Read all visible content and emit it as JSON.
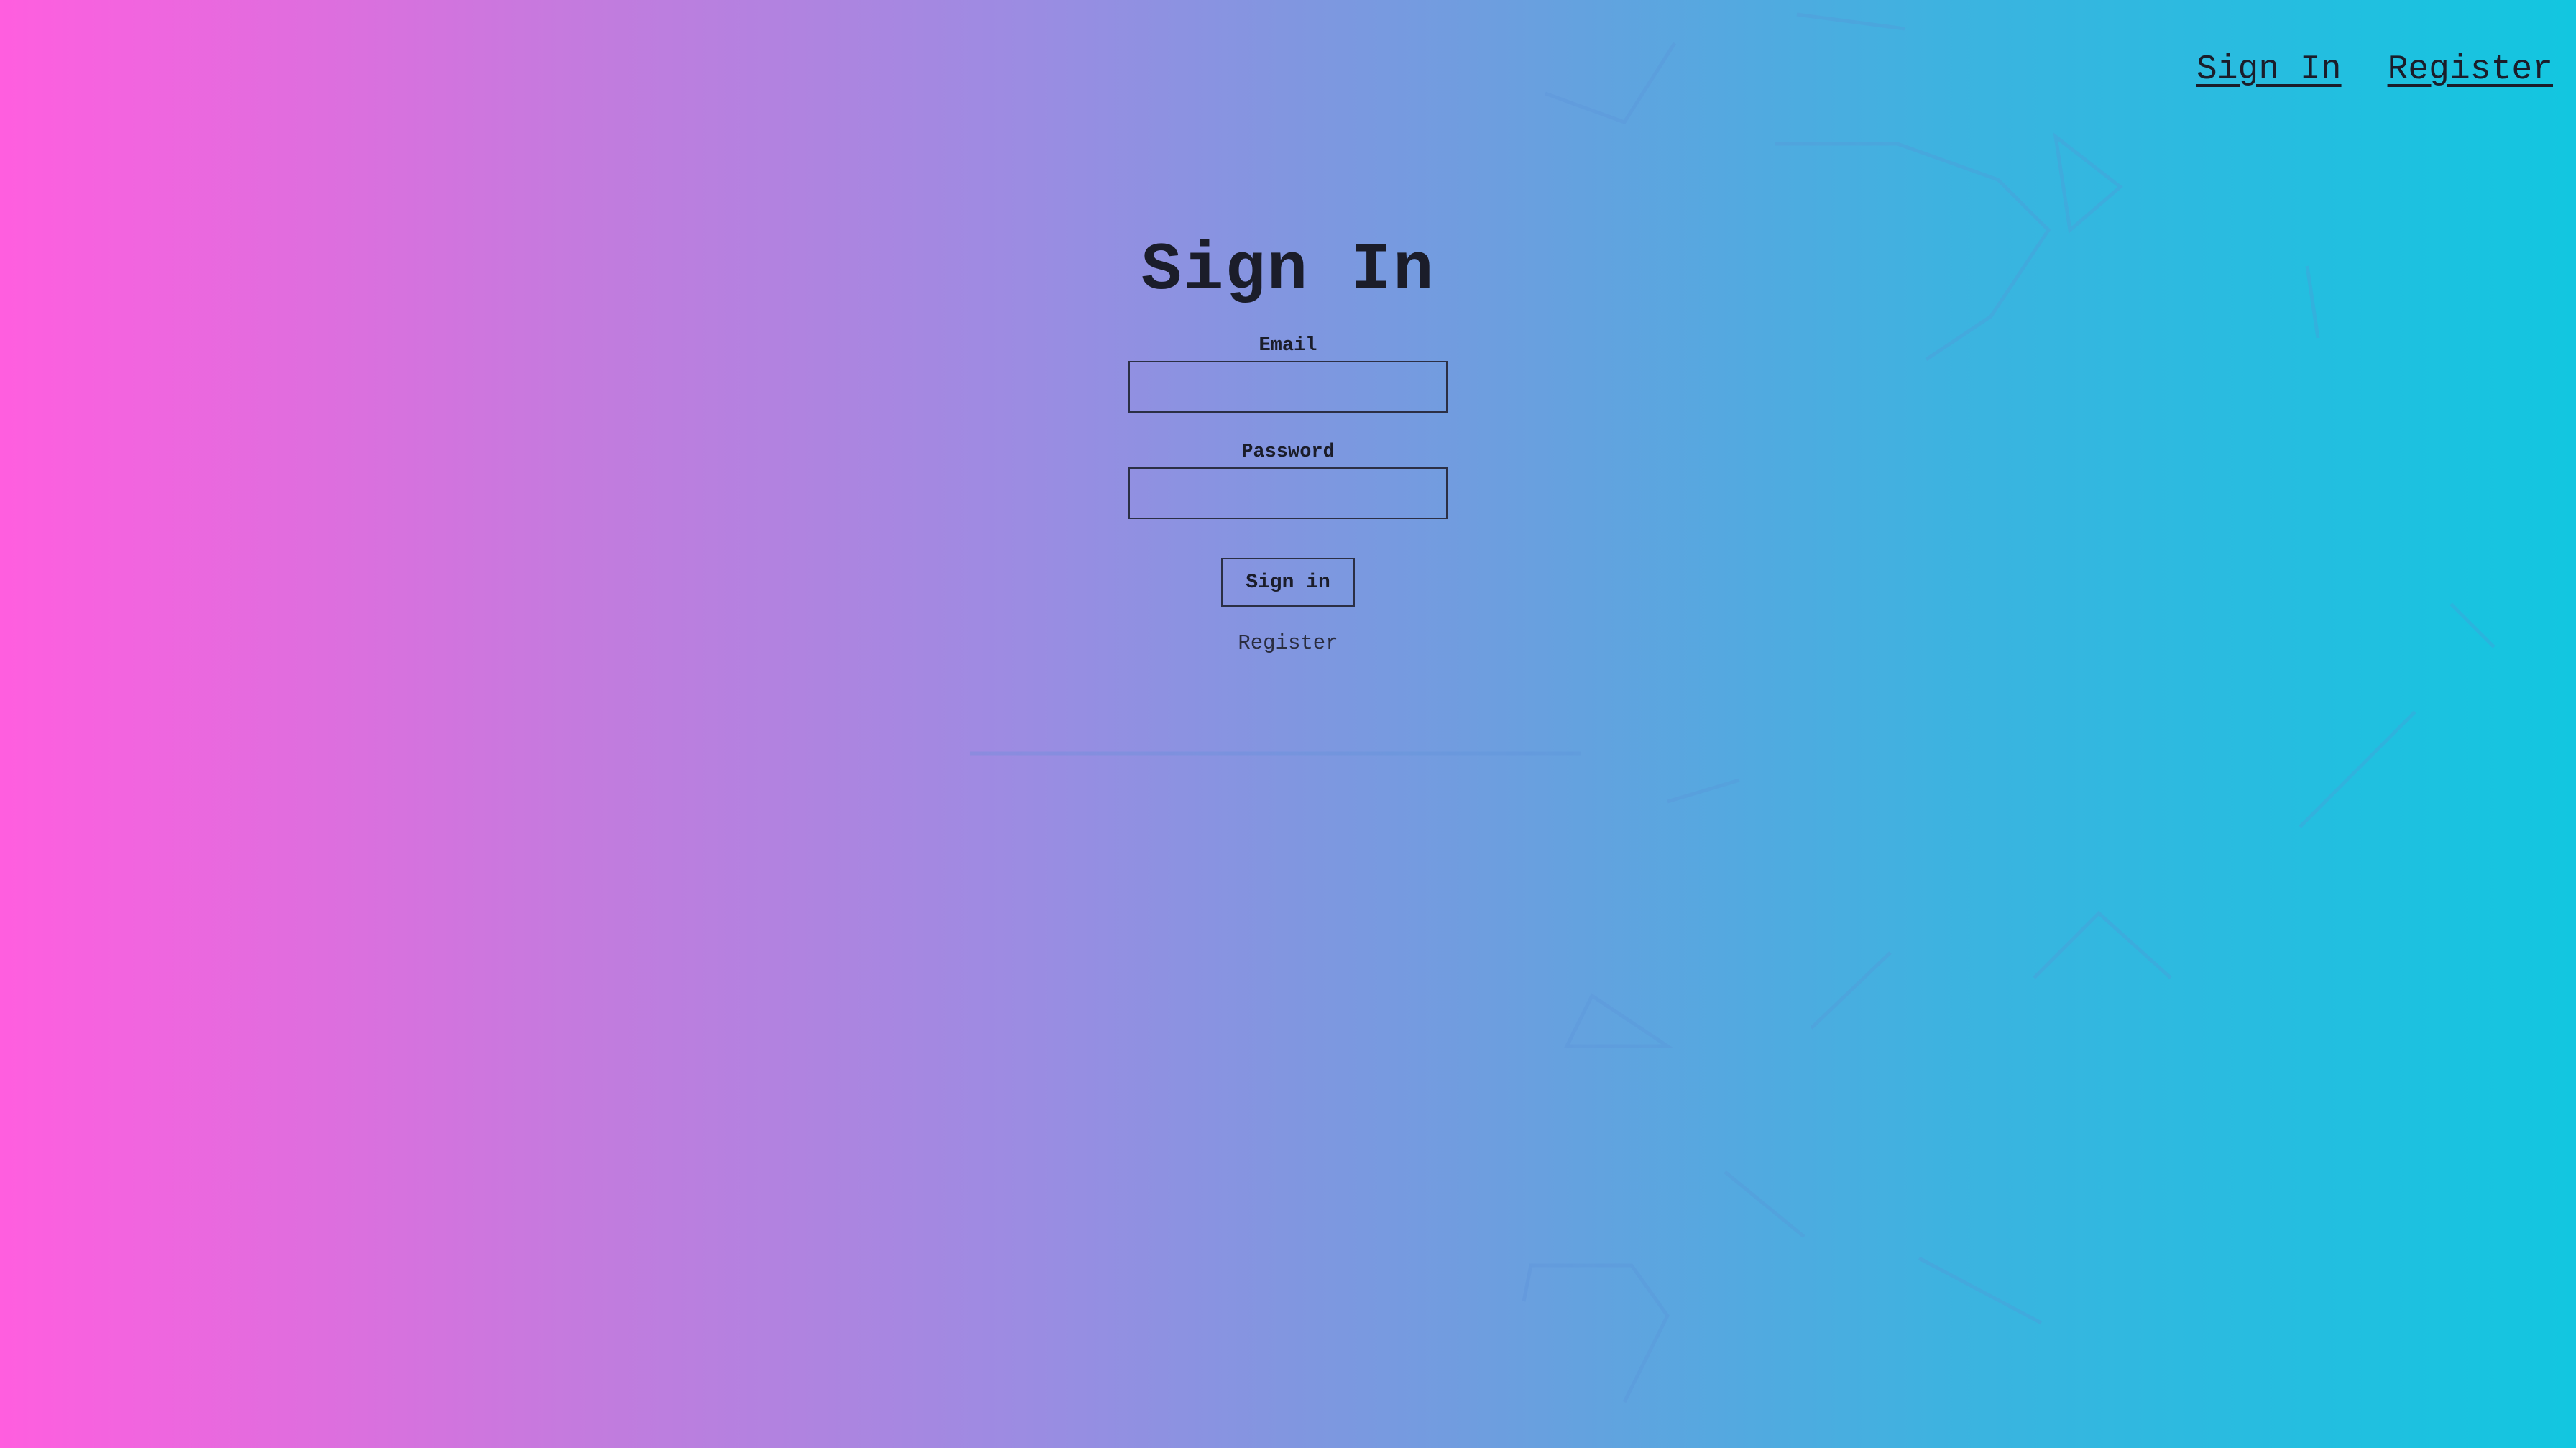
{
  "nav": {
    "sign_in": "Sign In",
    "register": "Register"
  },
  "form": {
    "title": "Sign In",
    "email_label": "Email",
    "email_value": "",
    "password_label": "Password",
    "password_value": "",
    "submit_label": "Sign in",
    "register_link": "Register"
  },
  "colors": {
    "gradient_left": "#ff5edf",
    "gradient_right": "#12c6e0",
    "text": "#1b1d2a"
  }
}
